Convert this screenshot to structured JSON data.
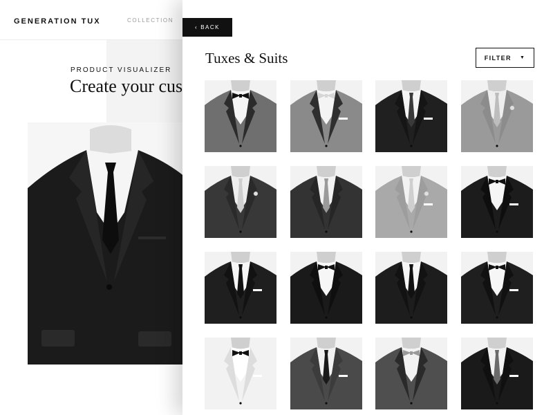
{
  "header": {
    "brand": "GENERATION TUX",
    "nav": {
      "collection": "COLLECTION"
    }
  },
  "visualizer": {
    "eyebrow": "PRODUCT VISUALIZER",
    "headline": "Create your cus"
  },
  "panel": {
    "back_label": "BACK",
    "back_icon": "chevron-left-icon",
    "title": "Tuxes & Suits",
    "filter_label": "FILTER",
    "filter_icon": "caret-down-icon"
  },
  "products": [
    {
      "jacket": "#6f6f6f",
      "lapel": "#2b2b2b",
      "shirt": "#f4f4f4",
      "tie": "bow",
      "tieColor": "#111111",
      "pocket": false,
      "flower": false
    },
    {
      "jacket": "#8a8a8a",
      "lapel": "#2f2f2f",
      "shirt": "#f4f4f4",
      "tie": "bow",
      "tieColor": "#d6d6d6",
      "pocket": true,
      "flower": false
    },
    {
      "jacket": "#202020",
      "lapel": "#151515",
      "shirt": "#f4f4f4",
      "tie": "long",
      "tieColor": "#3a3a3a",
      "pocket": true,
      "flower": false
    },
    {
      "jacket": "#9a9a9a",
      "lapel": "#8c8c8c",
      "shirt": "#eeeeee",
      "tie": "long",
      "tieColor": "#bdbdbd",
      "pocket": false,
      "flower": true
    },
    {
      "jacket": "#383838",
      "lapel": "#2a2a2a",
      "shirt": "#eeeeee",
      "tie": "long",
      "tieColor": "#cfcfcf",
      "pocket": false,
      "flower": true
    },
    {
      "jacket": "#333333",
      "lapel": "#262626",
      "shirt": "#f2f2f2",
      "tie": "long",
      "tieColor": "#9a9a9a",
      "pocket": false,
      "flower": false
    },
    {
      "jacket": "#a9a9a9",
      "lapel": "#9d9d9d",
      "shirt": "#f2f2f2",
      "tie": "long",
      "tieColor": "#cfcfcf",
      "pocket": true,
      "flower": true
    },
    {
      "jacket": "#1c1c1c",
      "lapel": "#0e0e0e",
      "shirt": "#f6f6f6",
      "tie": "bow",
      "tieColor": "#111111",
      "pocket": true,
      "flower": false
    },
    {
      "jacket": "#1f1f1f",
      "lapel": "#121212",
      "shirt": "#f6f6f6",
      "tie": "long",
      "tieColor": "#111111",
      "pocket": true,
      "flower": false
    },
    {
      "jacket": "#1a1a1a",
      "lapel": "#0f0f0f",
      "shirt": "#f6f6f6",
      "tie": "bow",
      "tieColor": "#111111",
      "pocket": false,
      "flower": false
    },
    {
      "jacket": "#1d1d1d",
      "lapel": "#121212",
      "shirt": "#f6f6f6",
      "tie": "long",
      "tieColor": "#111111",
      "pocket": false,
      "flower": false
    },
    {
      "jacket": "#1f1f1f",
      "lapel": "#111111",
      "shirt": "#f6f6f6",
      "tie": "bow",
      "tieColor": "#111111",
      "pocket": true,
      "flower": false
    },
    {
      "jacket": "#f2f2f2",
      "lapel": "#dddddd",
      "shirt": "#ffffff",
      "tie": "bow",
      "tieColor": "#111111",
      "pocket": true,
      "flower": false
    },
    {
      "jacket": "#4a4a4a",
      "lapel": "#3c3c3c",
      "shirt": "#f2f2f2",
      "tie": "long",
      "tieColor": "#1a1a1a",
      "pocket": true,
      "flower": false
    },
    {
      "jacket": "#4f4f4f",
      "lapel": "#2a2a2a",
      "shirt": "#f2f2f2",
      "tie": "bow",
      "tieColor": "#9a9a9a",
      "pocket": false,
      "flower": false
    },
    {
      "jacket": "#1a1a1a",
      "lapel": "#101010",
      "shirt": "#f2f2f2",
      "tie": "long",
      "tieColor": "#6a6a6a",
      "pocket": true,
      "flower": false
    }
  ]
}
